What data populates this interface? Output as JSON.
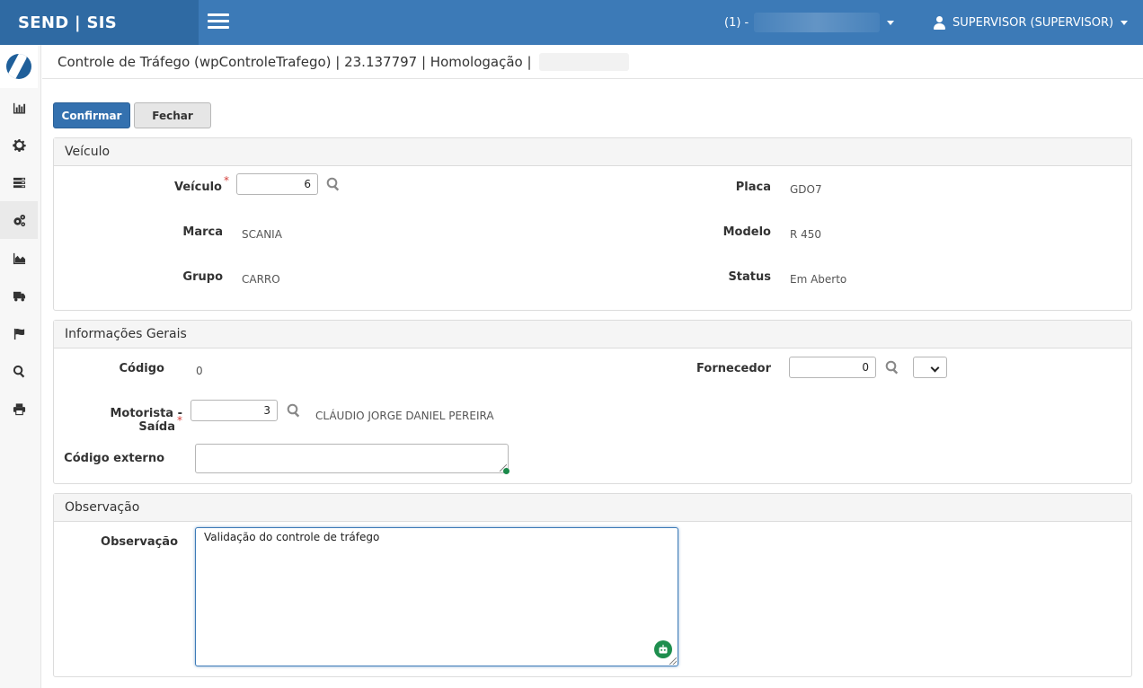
{
  "app": {
    "brand": "SEND | SIS"
  },
  "header": {
    "company_prefix": "(1) -",
    "user": "SUPERVISOR (SUPERVISOR)"
  },
  "sidebar": {
    "items": [
      {
        "icon": "bar-chart-icon"
      },
      {
        "icon": "gear-icon"
      },
      {
        "icon": "list-icon"
      },
      {
        "icon": "gears-icon",
        "active": true
      },
      {
        "icon": "area-chart-icon"
      },
      {
        "icon": "truck-icon"
      },
      {
        "icon": "flag-icon"
      },
      {
        "icon": "search-icon"
      },
      {
        "icon": "print-icon"
      }
    ]
  },
  "breadcrumb": {
    "text": "Controle de Tráfego (wpControleTrafego) | 23.137797 | Homologação |"
  },
  "toolbar": {
    "confirm_label": "Confirmar",
    "close_label": "Fechar"
  },
  "vehicle_panel": {
    "title": "Veículo",
    "vehicle_label": "Veículo",
    "vehicle_value": "6",
    "plate_label": "Placa",
    "plate_value": "GDO7",
    "brand_label": "Marca",
    "brand_value": "SCANIA",
    "model_label": "Modelo",
    "model_value": "R 450",
    "group_label": "Grupo",
    "group_value": "CARRO",
    "status_label": "Status",
    "status_value": "Em Aberto"
  },
  "general_panel": {
    "title": "Informações Gerais",
    "code_label": "Código",
    "code_value": "0",
    "supplier_label": "Fornecedor",
    "supplier_value": "0",
    "driver_label": "Motorista - Saída",
    "driver_value": "3",
    "driver_name": "CLÁUDIO JORGE DANIEL PEREIRA",
    "external_code_label": "Código externo",
    "external_code_value": ""
  },
  "observation_panel": {
    "title": "Observação",
    "label": "Observação",
    "value": "Validação do controle de tráfego"
  },
  "colors": {
    "topbar": "#3c7ab7",
    "brand_bg": "#2f6aa3",
    "primary_button": "#3471af",
    "required": "#d43f3a",
    "assist": "#1e8e4e"
  }
}
